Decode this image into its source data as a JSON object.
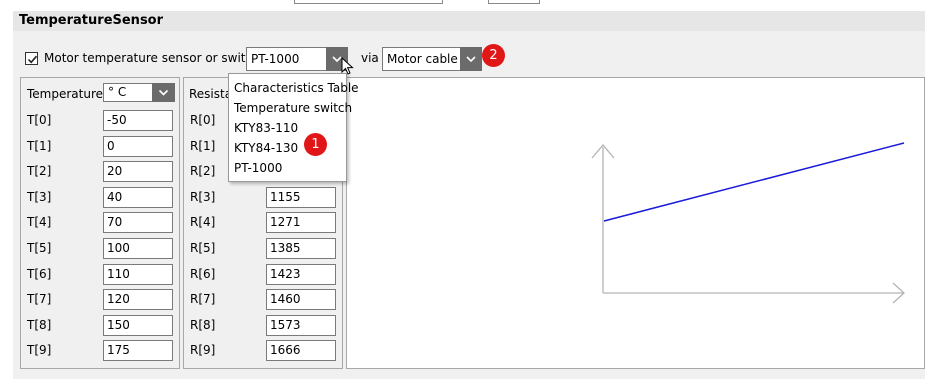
{
  "header": {
    "title": "TemperatureSensor"
  },
  "sensor": {
    "checkbox_label": "Motor temperature sensor or switch",
    "checked": true,
    "type_selected": "PT-1000",
    "via_label": "via",
    "via_selected": "Motor cable"
  },
  "temperature": {
    "header": "Temperature",
    "unit_selected": "° C",
    "rows": [
      {
        "label": "T[0]",
        "value": "-50"
      },
      {
        "label": "T[1]",
        "value": "0"
      },
      {
        "label": "T[2]",
        "value": "20"
      },
      {
        "label": "T[3]",
        "value": "40"
      },
      {
        "label": "T[4]",
        "value": "70"
      },
      {
        "label": "T[5]",
        "value": "100"
      },
      {
        "label": "T[6]",
        "value": "110"
      },
      {
        "label": "T[7]",
        "value": "120"
      },
      {
        "label": "T[8]",
        "value": "150"
      },
      {
        "label": "T[9]",
        "value": "175"
      }
    ]
  },
  "resistance": {
    "header": "Resistan",
    "rows": [
      {
        "label": "R[0]",
        "value": ""
      },
      {
        "label": "R[1]",
        "value": ""
      },
      {
        "label": "R[2]",
        "value": ""
      },
      {
        "label": "R[3]",
        "value": "1155"
      },
      {
        "label": "R[4]",
        "value": "1271"
      },
      {
        "label": "R[5]",
        "value": "1385"
      },
      {
        "label": "R[6]",
        "value": "1423"
      },
      {
        "label": "R[7]",
        "value": "1460"
      },
      {
        "label": "R[8]",
        "value": "1573"
      },
      {
        "label": "R[9]",
        "value": "1666"
      }
    ]
  },
  "dropdown": {
    "options": [
      "Characteristics Table",
      "Temperature switch",
      "KTY83-110",
      "KTY84-130",
      "PT-1000"
    ]
  },
  "badges": {
    "one": "1",
    "two": "2"
  },
  "colors": {
    "line": "#1a1adc",
    "badge": "#e11717",
    "axis": "#b4b4b4"
  }
}
